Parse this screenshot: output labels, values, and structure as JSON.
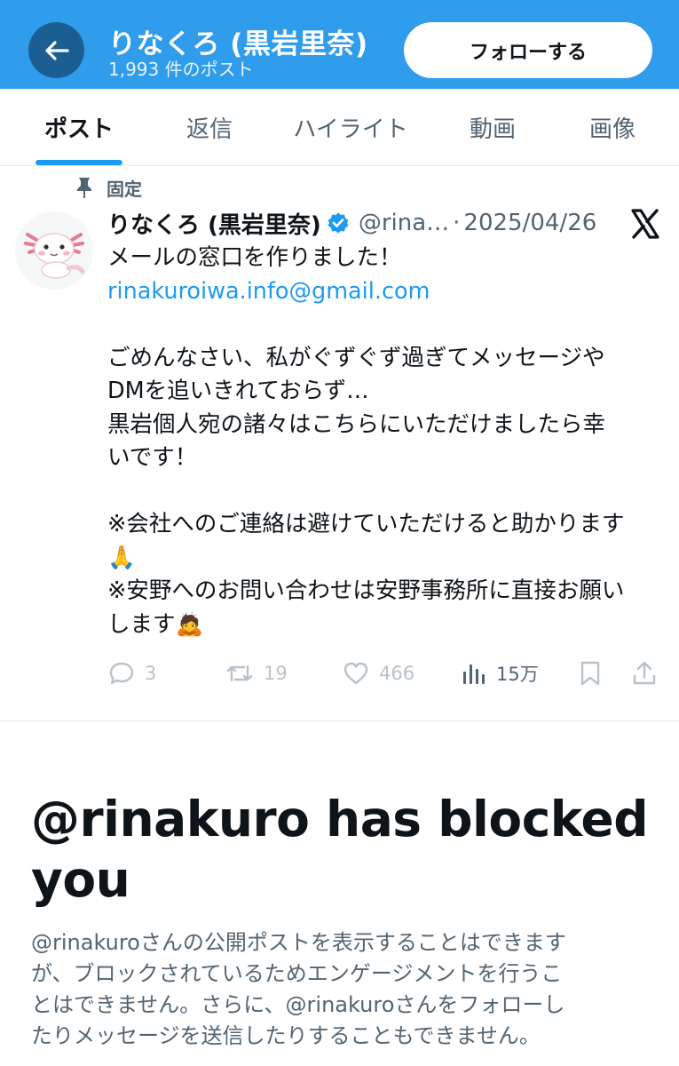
{
  "header": {
    "title": "りなくろ (黒岩里奈)",
    "post_count": "1,993 件のポスト",
    "follow_label": "フォローする",
    "colors": {
      "bar": "#2f9cec",
      "back_button": "#1b5f92"
    }
  },
  "tabs": [
    {
      "label": "ポスト",
      "active": true
    },
    {
      "label": "返信",
      "active": false
    },
    {
      "label": "ハイライト",
      "active": false
    },
    {
      "label": "動画",
      "active": false
    },
    {
      "label": "画像",
      "active": false
    }
  ],
  "post": {
    "pinned_label": "固定",
    "author_name": "りなくろ (黒岩里奈)",
    "verified": true,
    "handle": "@rina…",
    "date": "2025/04/26",
    "body_lines": [
      "メールの窓口を作りました！",
      "rinakuroiwa.info@gmail.com",
      "",
      "ごめんなさい、私がぐずぐず過ぎてメッセージや",
      "DMを追いきれておらず…",
      "黒岩個人宛の諸々はこちらにいただけましたら幸",
      "いです！",
      "",
      "※会社へのご連絡は避けていただけると助かります",
      "🙏",
      "※安野へのお問い合わせは安野事務所に直接お願い",
      "します🙇"
    ],
    "actions": {
      "replies": "3",
      "reposts": "19",
      "likes": "466",
      "views": "15万"
    },
    "icons": [
      "pin-icon",
      "avatar-axolotl",
      "verified-badge-icon",
      "x-logo-icon",
      "reply-icon",
      "repost-icon",
      "like-icon",
      "views-icon",
      "bookmark-icon",
      "share-icon"
    ],
    "link_color": "#1d9bf0"
  },
  "blocked": {
    "title_line1": "@rinakuro has blocked",
    "title_line2": "you",
    "desc_lines": [
      "@rinakuroさんの公開ポストを表示することはできます",
      "が、ブロックされているためエンゲージメントを行うこ",
      "とはできません。さらに、@rinakuroさんをフォローし",
      "たりメッセージを送信したりすることもできません。"
    ]
  }
}
